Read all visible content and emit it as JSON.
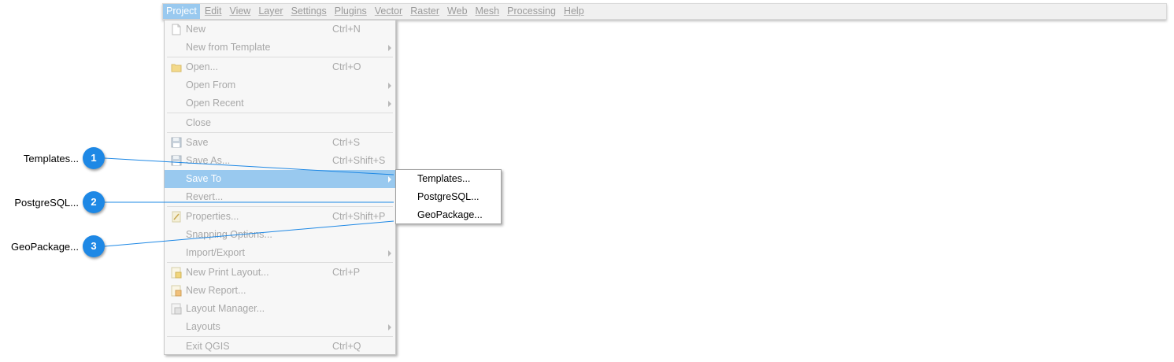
{
  "menubar": {
    "items": [
      "Project",
      "Edit",
      "View",
      "Layer",
      "Settings",
      "Plugins",
      "Vector",
      "Raster",
      "Web",
      "Mesh",
      "Processing",
      "Help"
    ]
  },
  "project_menu": {
    "items": [
      {
        "label": "New",
        "shortcut": "Ctrl+N",
        "icon": "new-file-icon"
      },
      {
        "label": "New from Template",
        "shortcut": "",
        "submenu": true
      },
      {
        "label": "Open...",
        "shortcut": "Ctrl+O",
        "icon": "folder-icon"
      },
      {
        "label": "Open From",
        "shortcut": "",
        "submenu": true
      },
      {
        "label": "Open Recent",
        "shortcut": "",
        "submenu": true
      },
      {
        "label": "Close",
        "shortcut": ""
      },
      {
        "label": "Save",
        "shortcut": "Ctrl+S",
        "icon": "save-icon"
      },
      {
        "label": "Save As...",
        "shortcut": "Ctrl+Shift+S",
        "icon": "save-as-icon"
      },
      {
        "label": "Save To",
        "shortcut": "",
        "submenu": true
      },
      {
        "label": "Revert...",
        "shortcut": ""
      },
      {
        "label": "Properties...",
        "shortcut": "Ctrl+Shift+P",
        "icon": "properties-icon"
      },
      {
        "label": "Snapping Options...",
        "shortcut": ""
      },
      {
        "label": "Import/Export",
        "shortcut": "",
        "submenu": true
      },
      {
        "label": "New Print Layout...",
        "shortcut": "Ctrl+P",
        "icon": "print-layout-icon"
      },
      {
        "label": "New Report...",
        "shortcut": "",
        "icon": "report-icon"
      },
      {
        "label": "Layout Manager...",
        "shortcut": "",
        "icon": "layout-manager-icon"
      },
      {
        "label": "Layouts",
        "shortcut": "",
        "submenu": true
      },
      {
        "label": "Exit QGIS",
        "shortcut": "Ctrl+Q"
      }
    ]
  },
  "save_to_submenu": {
    "items": [
      "Templates...",
      "PostgreSQL...",
      "GeoPackage..."
    ]
  },
  "callouts": [
    {
      "number": "1",
      "label": "Templates..."
    },
    {
      "number": "2",
      "label": "PostgreSQL..."
    },
    {
      "number": "3",
      "label": "GeoPackage..."
    }
  ],
  "colors": {
    "highlight": "#99c9ef",
    "badge": "#1e88e5",
    "line": "#1e88e5"
  }
}
